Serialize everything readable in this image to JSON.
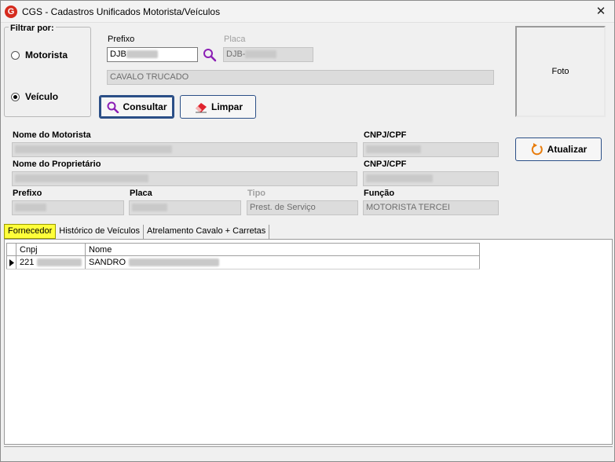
{
  "window": {
    "title": "CGS - Cadastros Unificados Motorista/Veículos",
    "close_glyph": "✕"
  },
  "filter": {
    "title": "Filtrar por:",
    "options": [
      {
        "label": "Motorista",
        "checked": false
      },
      {
        "label": "Veículo",
        "checked": true
      }
    ]
  },
  "search": {
    "prefixo_label": "Prefixo",
    "prefixo_value": "DJB",
    "placa_label": "Placa",
    "placa_value": "DJB-",
    "description": "CAVALO TRUCADO"
  },
  "buttons": {
    "consultar": "Consultar",
    "limpar": "Limpar",
    "atualizar": "Atualizar"
  },
  "photo": {
    "label": "Foto"
  },
  "details": {
    "motorista_label": "Nome do Motorista",
    "cnpj_label_1": "CNPJ/CPF",
    "proprietario_label": "Nome do Proprietário",
    "cnpj_label_2": "CNPJ/CPF",
    "prefixo_label": "Prefixo",
    "placa_label": "Placa",
    "tipo_label": "Tipo",
    "tipo_value": "Prest. de Serviço",
    "funcao_label": "Função",
    "funcao_value": "MOTORISTA TERCEI"
  },
  "tabs": [
    {
      "label": "Fornecedor",
      "active": true
    },
    {
      "label": "Histórico de Veículos",
      "active": false
    },
    {
      "label": "Atrelamento Cavalo + Carretas",
      "active": false
    }
  ],
  "grid": {
    "columns": [
      "Cnpj",
      "Nome"
    ],
    "rows": [
      {
        "cnpj": "221",
        "nome": "SANDRO"
      }
    ]
  },
  "colors": {
    "accent_border": "#2b4f87",
    "active_tab": "#ffff3a",
    "logo": "#d52b1e"
  }
}
